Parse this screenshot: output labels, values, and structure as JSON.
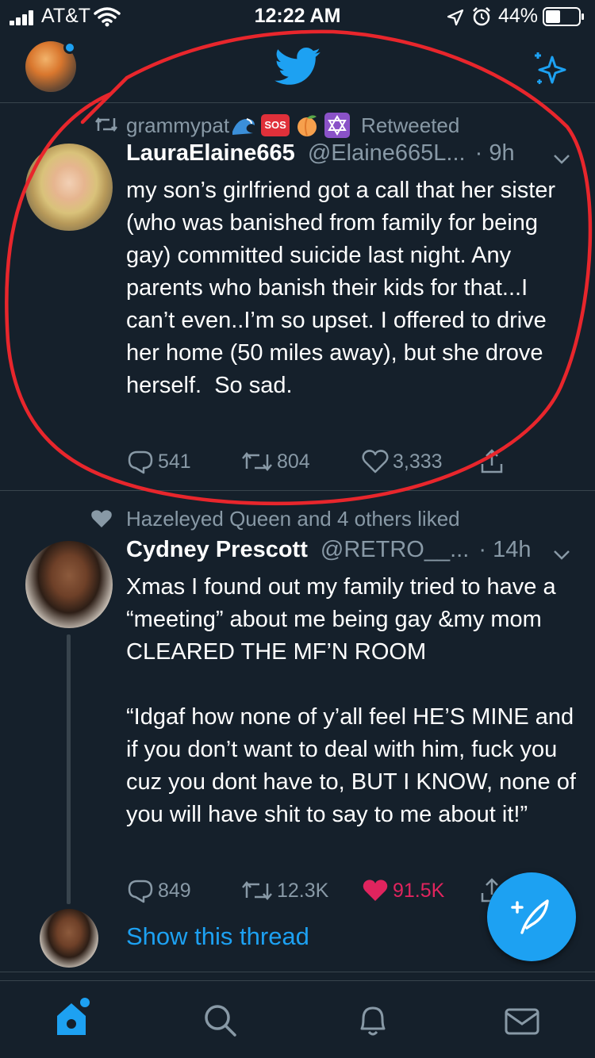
{
  "status_bar": {
    "carrier": "AT&T",
    "time": "12:22 AM",
    "battery_percent": "44%",
    "battery_level": 0.44
  },
  "header": {
    "logo_icon": "twitter-bird-icon",
    "sparkle_icon": "sparkle-icon"
  },
  "tweets": [
    {
      "social_context": {
        "user": "grammypat",
        "emojis": [
          "wave",
          "SOS",
          "peach",
          "star-of-david"
        ],
        "sos_text": "SOS",
        "action": "Retweeted"
      },
      "display_name": "LauraElaine665",
      "handle": "@Elaine665L...",
      "time": "· 9h",
      "text": "my son’s girlfriend got a call that her sister (who was banished from family for being gay) committed suicide last night. Any parents who banish their kids for that...I can’t even..I’m so upset. I offered to drive her home (50 miles away), but she drove herself.  So sad.",
      "replies": "541",
      "retweets": "804",
      "likes": "3,333",
      "liked": false
    },
    {
      "social_context": {
        "text": "Hazeleyed Queen and 4 others liked"
      },
      "display_name": "Cydney Prescott",
      "handle": "@RETRO__...",
      "time": "· 14h",
      "text": "Xmas I found out my family tried to have a “meeting” about me being gay &my mom CLEARED THE MF’N ROOM\n\n“Idgaf how none of y’all feel HE’S MINE and if you don’t want to deal with him, fuck you cuz you dont have to, BUT I KNOW, none of you will have shit to say to me about it!”",
      "replies": "849",
      "retweets": "12.3K",
      "likes": "91.5K",
      "liked": true,
      "show_thread": "Show this thread"
    }
  ],
  "colors": {
    "background": "#15202b",
    "accent": "#1da1f2",
    "muted": "#8899a6",
    "like": "#e0245e",
    "annotation": "#e8262c",
    "divider": "#38444d"
  },
  "bottom_nav": [
    "home-icon",
    "search-icon",
    "notifications-bell-icon",
    "messages-envelope-icon"
  ]
}
